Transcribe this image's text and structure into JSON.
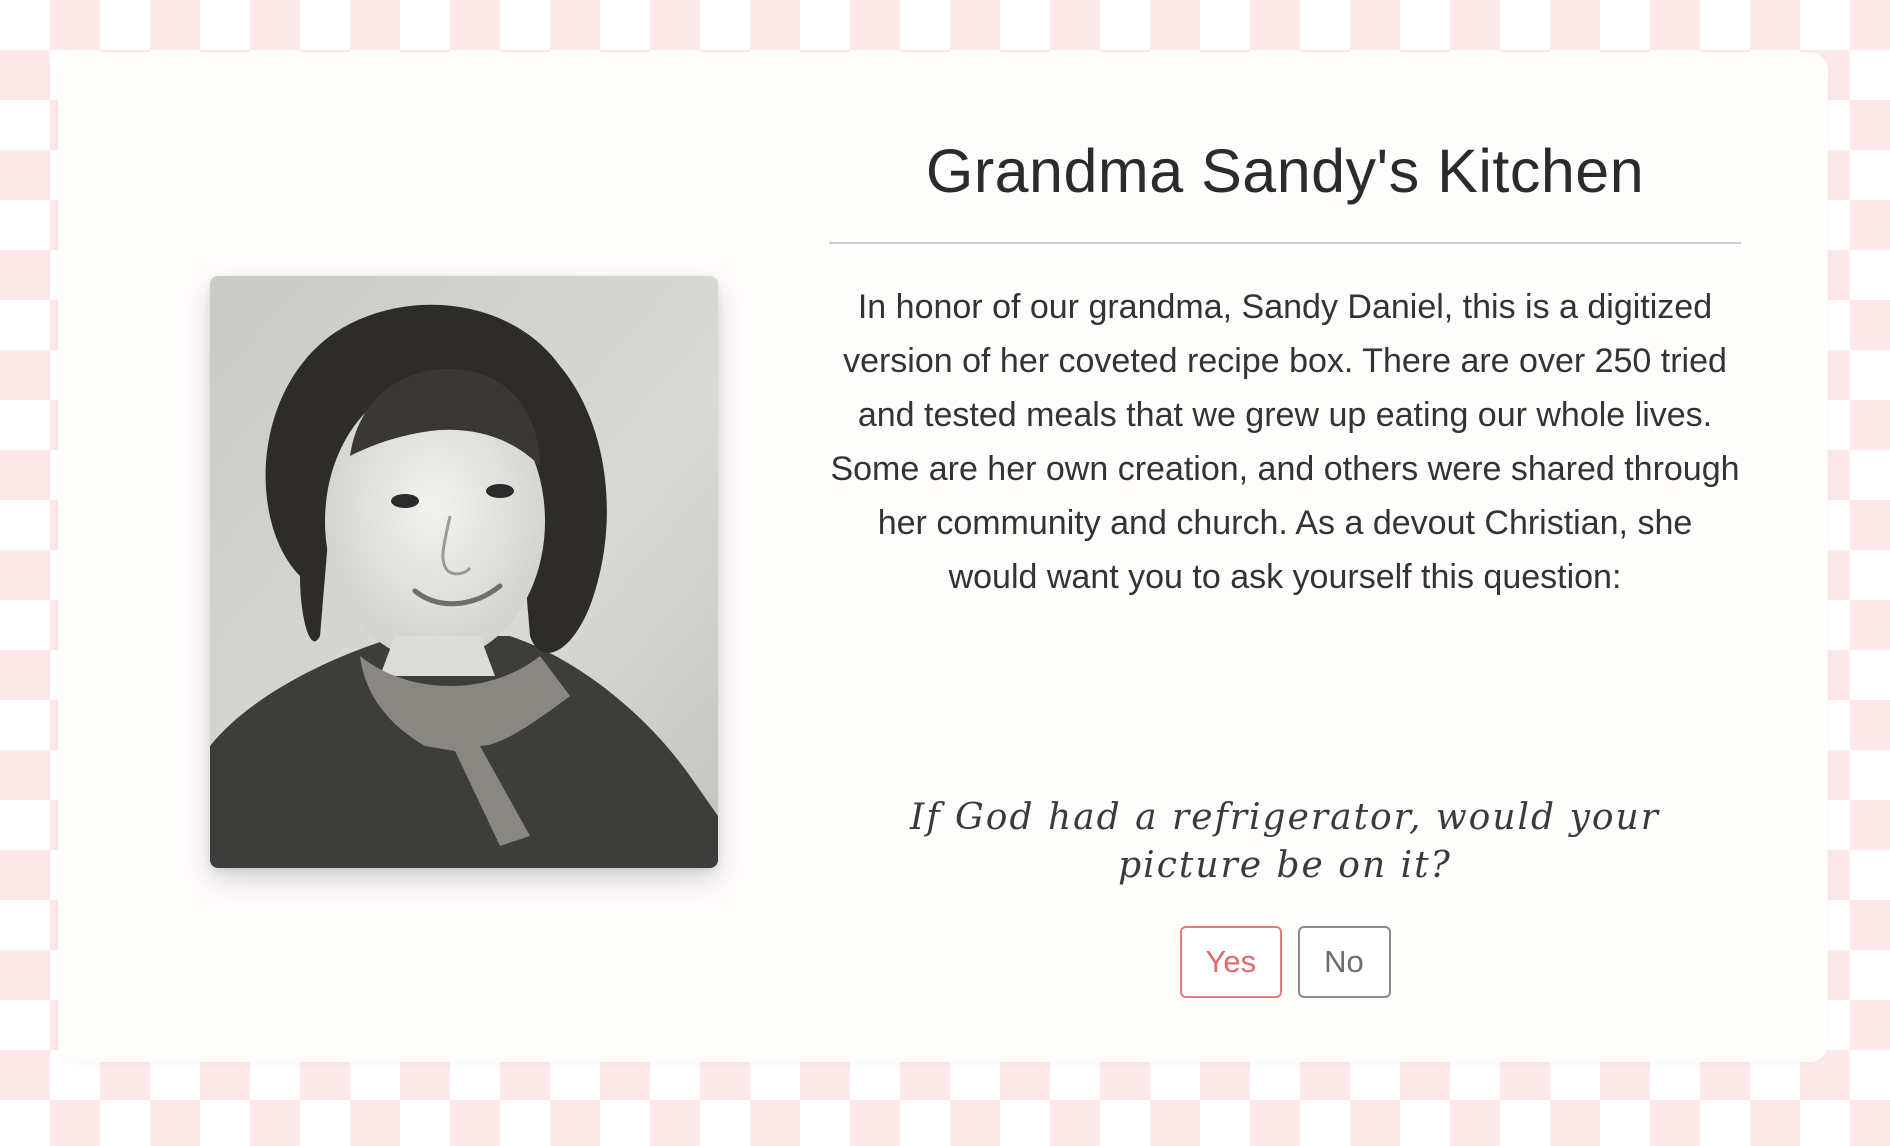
{
  "header": {
    "title": "Grandma Sandy's Kitchen"
  },
  "intro": {
    "text": "In honor of our grandma, Sandy Daniel, this is a digitized version of her coveted recipe box. There are over 250 tried and tested meals that we grew up eating our whole lives. Some are her own creation, and others were shared through her community and church. As a devout Christian, she would want you to ask yourself this question:"
  },
  "question": {
    "text": "If God had a refrigerator, would your picture be on it?"
  },
  "answers": {
    "yes_label": "Yes",
    "no_label": "No"
  },
  "colors": {
    "checker": "#fde9e9",
    "card_bg": "#fffdfc",
    "yes_accent": "#e06a6a",
    "no_accent": "#6d6d6d"
  },
  "photo": {
    "icon": "vintage-portrait-photo"
  }
}
